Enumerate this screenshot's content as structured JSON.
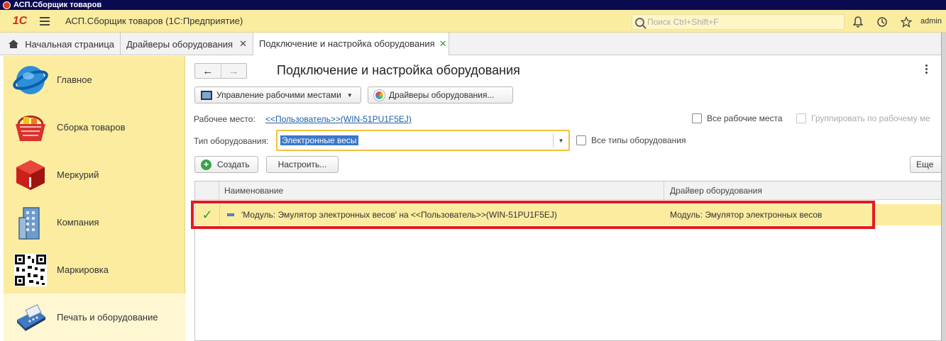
{
  "window": {
    "title": "АСП.Сборщик товаров"
  },
  "header": {
    "logo_text": "1С",
    "app_title": "АСП.Сборщик товаров  (1С:Предприятие)",
    "search_placeholder": "Поиск Ctrl+Shift+F",
    "user": "admin",
    "icons": [
      "bell-icon",
      "history-icon",
      "star-icon"
    ]
  },
  "tabs": [
    {
      "label": "Начальная страница",
      "closable": false
    },
    {
      "label": "Драйверы оборудования",
      "closable": true
    },
    {
      "label": "Подключение и настройка оборудования",
      "closable": true,
      "active": true
    }
  ],
  "sidebar": {
    "items": [
      {
        "label": "Главное",
        "icon": "globe-icon"
      },
      {
        "label": "Сборка товаров",
        "icon": "basket-icon"
      },
      {
        "label": "Меркурий",
        "icon": "cube-icon"
      },
      {
        "label": "Компания",
        "icon": "building-icon"
      },
      {
        "label": "Маркировка",
        "icon": "qr-code-icon"
      },
      {
        "label": "Печать и оборудование",
        "icon": "card-terminal-icon",
        "active": true
      }
    ]
  },
  "form": {
    "title": "Подключение и настройка оборудования",
    "workplace_mgmt_button": "Управление рабочими местами",
    "drivers_button": "Драйверы оборудования...",
    "workplace_label": "Рабочее место:",
    "workplace_value": "<<Пользователь>>(WIN-51PU1F5EJ)",
    "all_workplaces_label": "Все рабочие места",
    "group_by_workplace_label": "Группировать по рабочему ме",
    "equipment_type_label": "Тип оборудования:",
    "equipment_type_value": "Электронные весы",
    "all_types_label": "Все типы оборудования",
    "create_button": "Создать",
    "configure_button": "Настроить...",
    "more_button": "Еще"
  },
  "table": {
    "columns": [
      "Наименование",
      "Драйвер оборудования"
    ],
    "rows": [
      {
        "checked": true,
        "name": "'Модуль: Эмулятор электронных весов' на <<Пользователь>>(WIN-51PU1F5EJ)",
        "driver": "Модуль: Эмулятор электронных весов"
      }
    ]
  },
  "colors": {
    "accent_yellow": "#fbeca0",
    "highlight_red": "#e11b22",
    "check_green": "#2a9d3c",
    "link_blue": "#1f5fa8"
  }
}
